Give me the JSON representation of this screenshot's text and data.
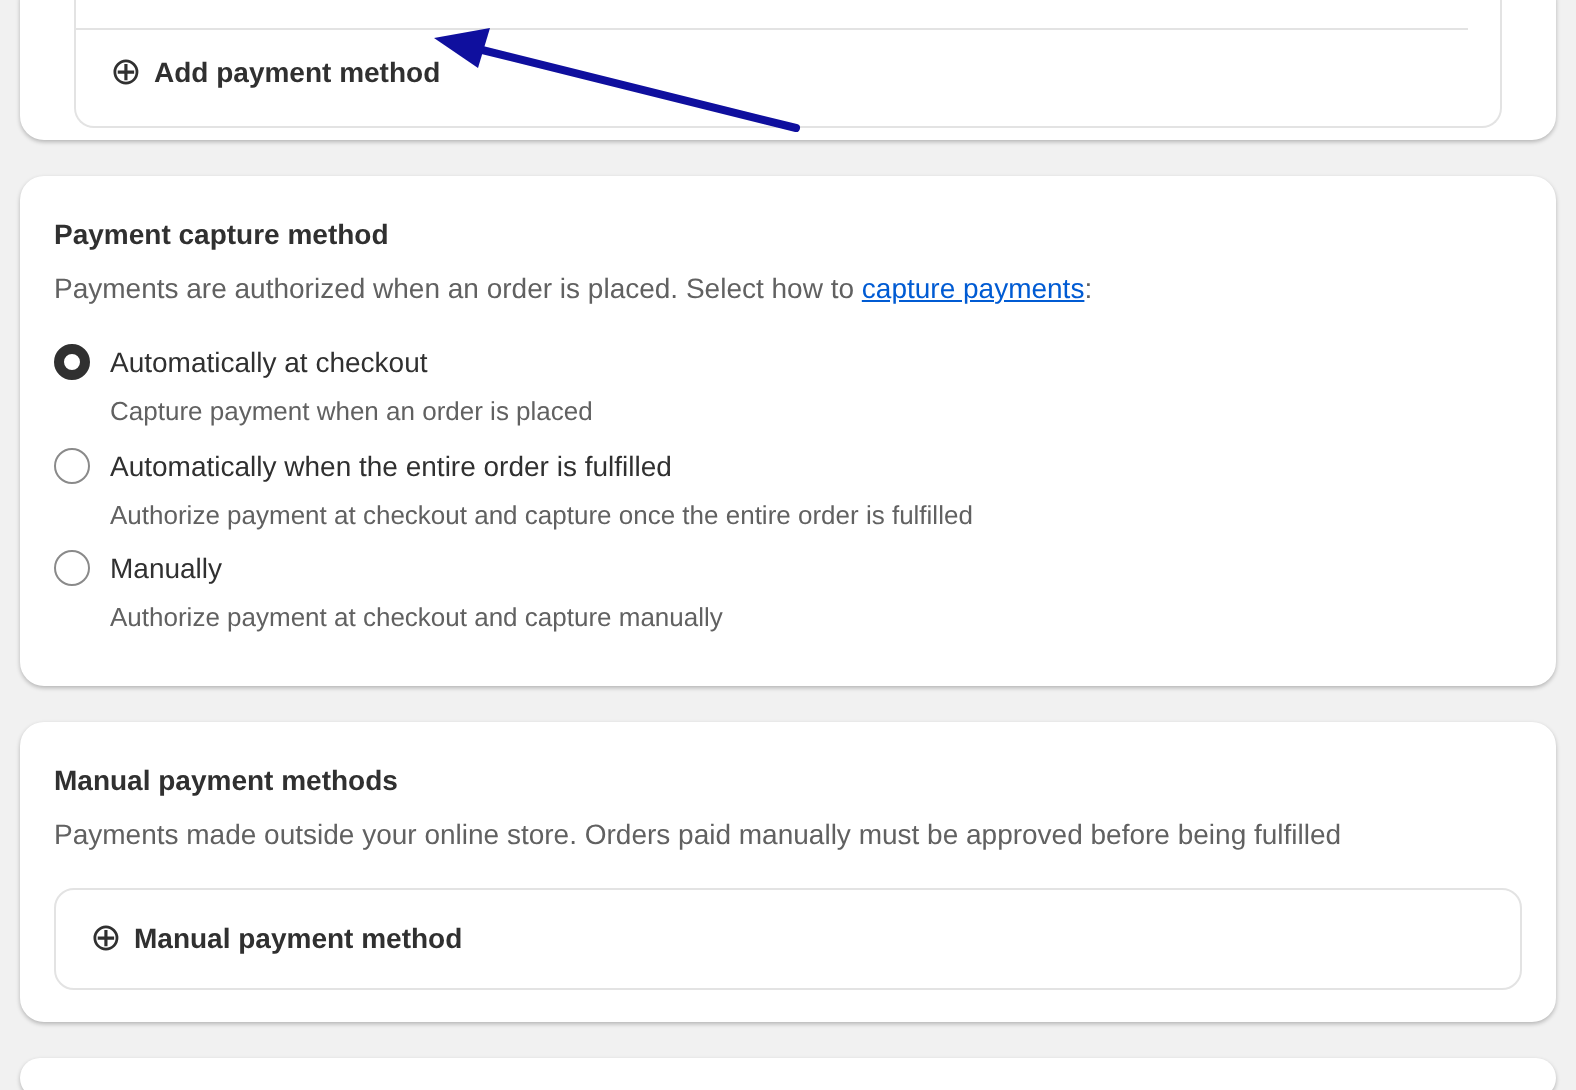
{
  "payment_providers": {
    "add_button": {
      "icon": "⊕",
      "label": "Add payment method"
    }
  },
  "capture": {
    "title": "Payment capture method",
    "description": "Payments are authorized when an order is placed. Select how to ",
    "link": "capture payments",
    "after_link": ":",
    "options": [
      {
        "label": "Automatically at checkout",
        "hint": "Capture payment when an order is placed",
        "selected": true
      },
      {
        "label": "Automatically when the entire order is fulfilled",
        "hint": "Authorize payment at checkout and capture once the entire order is fulfilled",
        "selected": false
      },
      {
        "label": "Manually",
        "hint": "Authorize payment at checkout and capture manually",
        "selected": false
      }
    ]
  },
  "manual": {
    "title": "Manual payment methods",
    "description": "Payments made outside your online store. Orders paid manually must be approved before being fulfilled",
    "add_button": {
      "icon": "⊕",
      "label": "Manual payment method"
    }
  }
}
